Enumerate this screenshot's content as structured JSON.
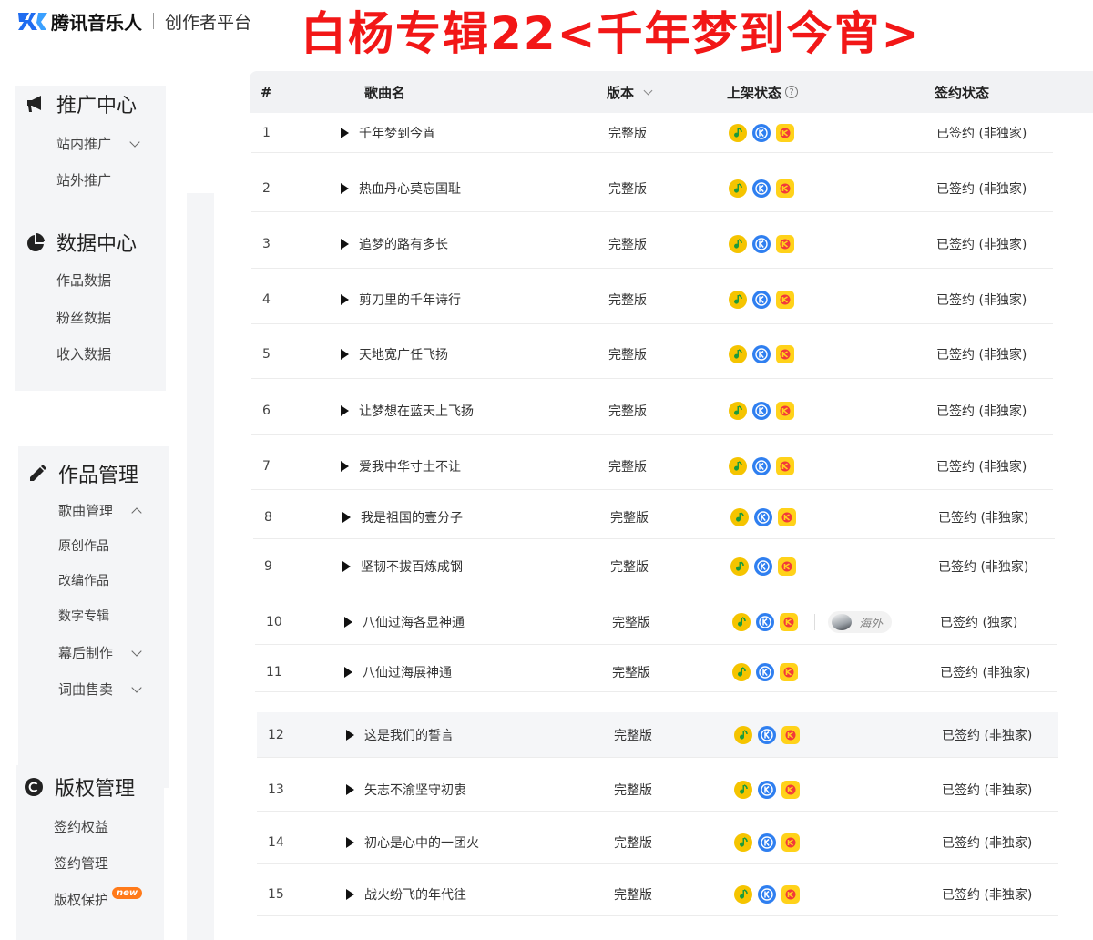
{
  "header": {
    "brand": "腾讯音乐人",
    "platform": "创作者平台",
    "album_title": "白杨专辑22<千年梦到今宵>"
  },
  "colors": {
    "album_title": "#f21717",
    "logo_blue": "#1f6cf0",
    "sidebar_bg": "#f4f5f7",
    "header_bg": "#f1f2f4",
    "qq_music": "#f5c400",
    "kugou": "#2f7ff0",
    "kuwo": "#ffd21a",
    "new_badge": "#ff7a1a"
  },
  "sidebar": {
    "promotion": {
      "title": "推广中心",
      "icon": "megaphone-icon",
      "items": [
        {
          "label": "站内推广",
          "expandable": true
        },
        {
          "label": "站外推广",
          "expandable": false
        }
      ]
    },
    "data": {
      "title": "数据中心",
      "icon": "pie-chart-icon",
      "items": [
        {
          "label": "作品数据"
        },
        {
          "label": "粉丝数据"
        },
        {
          "label": "收入数据"
        }
      ]
    },
    "works": {
      "title": "作品管理",
      "icon": "pencil-icon",
      "items": [
        {
          "label": "歌曲管理",
          "expanded": true
        },
        {
          "label": "原创作品"
        },
        {
          "label": "改编作品"
        },
        {
          "label": "数字专辑"
        },
        {
          "label": "幕后制作",
          "expandable": true
        },
        {
          "label": "词曲售卖",
          "expandable": true
        }
      ]
    },
    "copyright": {
      "title": "版权管理",
      "icon": "copyright-icon",
      "items": [
        {
          "label": "签约权益"
        },
        {
          "label": "签约管理"
        },
        {
          "label": "版权保护",
          "badge": "new"
        }
      ]
    }
  },
  "table": {
    "columns": {
      "index": "#",
      "name": "歌曲名",
      "version": "版本",
      "status": "上架状态",
      "sign": "签约状态"
    },
    "platform_icons": [
      "qq-music-icon",
      "kugou-icon",
      "kuwo-icon"
    ],
    "rows": [
      {
        "index": "1",
        "name": "千年梦到今宵",
        "version": "完整版",
        "sign": "已签约 (非独家)"
      },
      {
        "index": "2",
        "name": "热血丹心莫忘国耻",
        "version": "完整版",
        "sign": "已签约 (非独家)"
      },
      {
        "index": "3",
        "name": "追梦的路有多长",
        "version": "完整版",
        "sign": "已签约 (非独家)"
      },
      {
        "index": "4",
        "name": "剪刀里的千年诗行",
        "version": "完整版",
        "sign": "已签约 (非独家)"
      },
      {
        "index": "5",
        "name": "天地宽广任飞扬",
        "version": "完整版",
        "sign": "已签约 (非独家)"
      },
      {
        "index": "6",
        "name": "让梦想在蓝天上飞扬",
        "version": "完整版",
        "sign": "已签约 (非独家)"
      },
      {
        "index": "7",
        "name": "爱我中华寸土不让",
        "version": "完整版",
        "sign": "已签约 (非独家)"
      },
      {
        "index": "8",
        "name": "我是祖国的壹分子",
        "version": "完整版",
        "sign": "已签约 (非独家)"
      },
      {
        "index": "9",
        "name": "坚韧不拔百炼成钢",
        "version": "完整版",
        "sign": "已签约 (非独家)"
      },
      {
        "index": "10",
        "name": "八仙过海各显神通",
        "version": "完整版",
        "sign": "已签约 (独家)",
        "overseas": "海外"
      },
      {
        "index": "11",
        "name": "八仙过海展神通",
        "version": "完整版",
        "sign": "已签约 (非独家)"
      },
      {
        "index": "12",
        "name": "这是我们的誓言",
        "version": "完整版",
        "sign": "已签约 (非独家)",
        "highlighted": true
      },
      {
        "index": "13",
        "name": "矢志不渝坚守初衷",
        "version": "完整版",
        "sign": "已签约 (非独家)"
      },
      {
        "index": "14",
        "name": "初心是心中的一团火",
        "version": "完整版",
        "sign": "已签约 (非独家)"
      },
      {
        "index": "15",
        "name": "战火纷飞的年代往",
        "version": "完整版",
        "sign": "已签约 (非独家)"
      }
    ]
  }
}
